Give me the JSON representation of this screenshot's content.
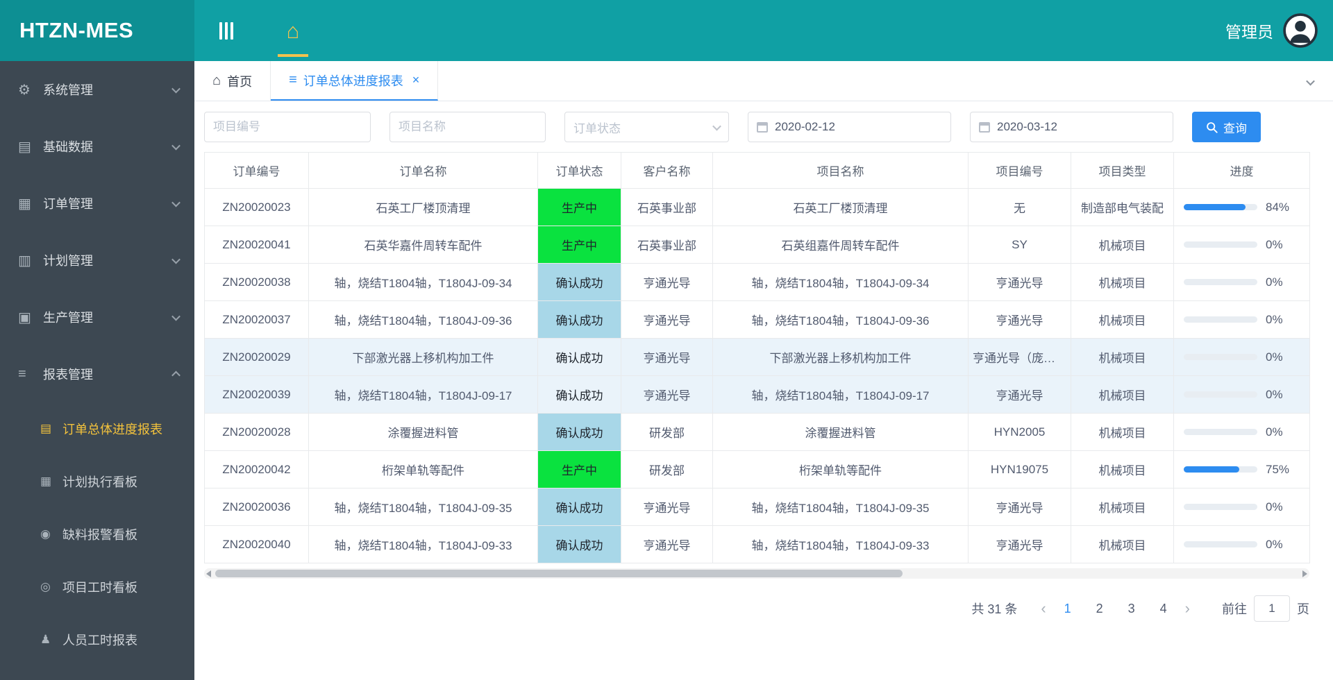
{
  "colors": {
    "header_teal": "#10a0a4",
    "logo_teal": "#0d8f93",
    "sidebar_bg": "#3d4852",
    "accent_blue": "#2d8cf0",
    "accent_gold": "#f2c24e",
    "status_green": "#0ae23f",
    "status_blue": "#a8d7e8"
  },
  "header": {
    "logo": "HTZN-MES",
    "user": "管理员"
  },
  "sidebar": {
    "items": [
      {
        "label": "系统管理",
        "icon": "gear-icon",
        "glyph": "⚙",
        "expanded": false
      },
      {
        "label": "基础数据",
        "icon": "database-icon",
        "glyph": "▤",
        "expanded": false
      },
      {
        "label": "订单管理",
        "icon": "order-icon",
        "glyph": "▦",
        "expanded": false
      },
      {
        "label": "计划管理",
        "icon": "plan-icon",
        "glyph": "▥",
        "expanded": false
      },
      {
        "label": "生产管理",
        "icon": "production-icon",
        "glyph": "▣",
        "expanded": false
      },
      {
        "label": "报表管理",
        "icon": "report-icon",
        "glyph": "≡",
        "expanded": true,
        "children": [
          {
            "label": "订单总体进度报表",
            "icon": "order-progress-report-icon",
            "glyph": "▤",
            "active": true
          },
          {
            "label": "计划执行看板",
            "icon": "plan-board-icon",
            "glyph": "▦",
            "active": false
          },
          {
            "label": "缺料报警看板",
            "icon": "shortage-alarm-icon",
            "glyph": "◉",
            "active": false
          },
          {
            "label": "项目工时看板",
            "icon": "project-hours-icon",
            "glyph": "◎",
            "active": false
          },
          {
            "label": "人员工时报表",
            "icon": "person-hours-icon",
            "glyph": "♟",
            "active": false
          }
        ]
      }
    ]
  },
  "tabs": {
    "close_glyph": "×",
    "items": [
      {
        "label": "首页",
        "icon": "home-icon",
        "glyph": "⌂",
        "active": false,
        "closable": false
      },
      {
        "label": "订单总体进度报表",
        "icon": "report-list-icon",
        "glyph": "≡",
        "active": true,
        "closable": true
      }
    ]
  },
  "filters": {
    "project_no": {
      "placeholder": "项目编号",
      "value": ""
    },
    "project_name": {
      "placeholder": "项目名称",
      "value": ""
    },
    "order_status": {
      "placeholder": "订单状态",
      "value": ""
    },
    "date_from": "2020-02-12",
    "date_to": "2020-03-12",
    "search_button": "查询"
  },
  "table": {
    "columns": [
      "订单编号",
      "订单名称",
      "订单状态",
      "客户名称",
      "项目名称",
      "项目编号",
      "项目类型",
      "进度"
    ],
    "rows": [
      {
        "order_no": "ZN20020023",
        "order_name": "石英工厂楼顶清理",
        "status": "生产中",
        "status_style": "green",
        "customer": "石英事业部",
        "project_name": "石英工厂楼顶清理",
        "project_no": "无",
        "project_type": "制造部电气装配",
        "progress": 84,
        "highlight": false
      },
      {
        "order_no": "ZN20020041",
        "order_name": "石英华嘉件周转车配件",
        "status": "生产中",
        "status_style": "green",
        "customer": "石英事业部",
        "project_name": "石英组嘉件周转车配件",
        "project_no": "SY",
        "project_type": "机械项目",
        "progress": 0,
        "highlight": false
      },
      {
        "order_no": "ZN20020038",
        "order_name": "轴，烧结T1804轴，T1804J-09-34",
        "status": "确认成功",
        "status_style": "blue",
        "customer": "亨通光导",
        "project_name": "轴，烧结T1804轴，T1804J-09-34",
        "project_no": "亨通光导",
        "project_type": "机械项目",
        "progress": 0,
        "highlight": false
      },
      {
        "order_no": "ZN20020037",
        "order_name": "轴，烧结T1804轴，T1804J-09-36",
        "status": "确认成功",
        "status_style": "blue",
        "customer": "亨通光导",
        "project_name": "轴，烧结T1804轴，T1804J-09-36",
        "project_no": "亨通光导",
        "project_type": "机械项目",
        "progress": 0,
        "highlight": false
      },
      {
        "order_no": "ZN20020029",
        "order_name": "下部激光器上移机构加工件",
        "status": "确认成功",
        "status_style": "blue",
        "customer": "亨通光导",
        "project_name": "下部激光器上移机构加工件",
        "project_no": "亨通光导（庞耀）",
        "project_type": "机械项目",
        "progress": 0,
        "highlight": true
      },
      {
        "order_no": "ZN20020039",
        "order_name": "轴，烧结T1804轴，T1804J-09-17",
        "status": "确认成功",
        "status_style": "blue",
        "customer": "亨通光导",
        "project_name": "轴，烧结T1804轴，T1804J-09-17",
        "project_no": "亨通光导",
        "project_type": "机械项目",
        "progress": 0,
        "highlight": true
      },
      {
        "order_no": "ZN20020028",
        "order_name": "涂覆握进料管",
        "status": "确认成功",
        "status_style": "blue",
        "customer": "研发部",
        "project_name": "涂覆握进料管",
        "project_no": "HYN2005",
        "project_type": "机械项目",
        "progress": 0,
        "highlight": false
      },
      {
        "order_no": "ZN20020042",
        "order_name": "桁架单轨等配件",
        "status": "生产中",
        "status_style": "green",
        "customer": "研发部",
        "project_name": "桁架单轨等配件",
        "project_no": "HYN19075",
        "project_type": "机械项目",
        "progress": 75,
        "highlight": false
      },
      {
        "order_no": "ZN20020036",
        "order_name": "轴，烧结T1804轴，T1804J-09-35",
        "status": "确认成功",
        "status_style": "blue",
        "customer": "亨通光导",
        "project_name": "轴，烧结T1804轴，T1804J-09-35",
        "project_no": "亨通光导",
        "project_type": "机械项目",
        "progress": 0,
        "highlight": false
      },
      {
        "order_no": "ZN20020040",
        "order_name": "轴，烧结T1804轴，T1804J-09-33",
        "status": "确认成功",
        "status_style": "blue",
        "customer": "亨通光导",
        "project_name": "轴，烧结T1804轴，T1804J-09-33",
        "project_no": "亨通光导",
        "project_type": "机械项目",
        "progress": 0,
        "highlight": false
      }
    ]
  },
  "pagination": {
    "total": "共 31 条",
    "prev_glyph": "‹",
    "next_glyph": "›",
    "pages": [
      "1",
      "2",
      "3",
      "4"
    ],
    "active_page": "1",
    "goto_label": "前往",
    "goto_value": "1",
    "goto_suffix": "页"
  }
}
